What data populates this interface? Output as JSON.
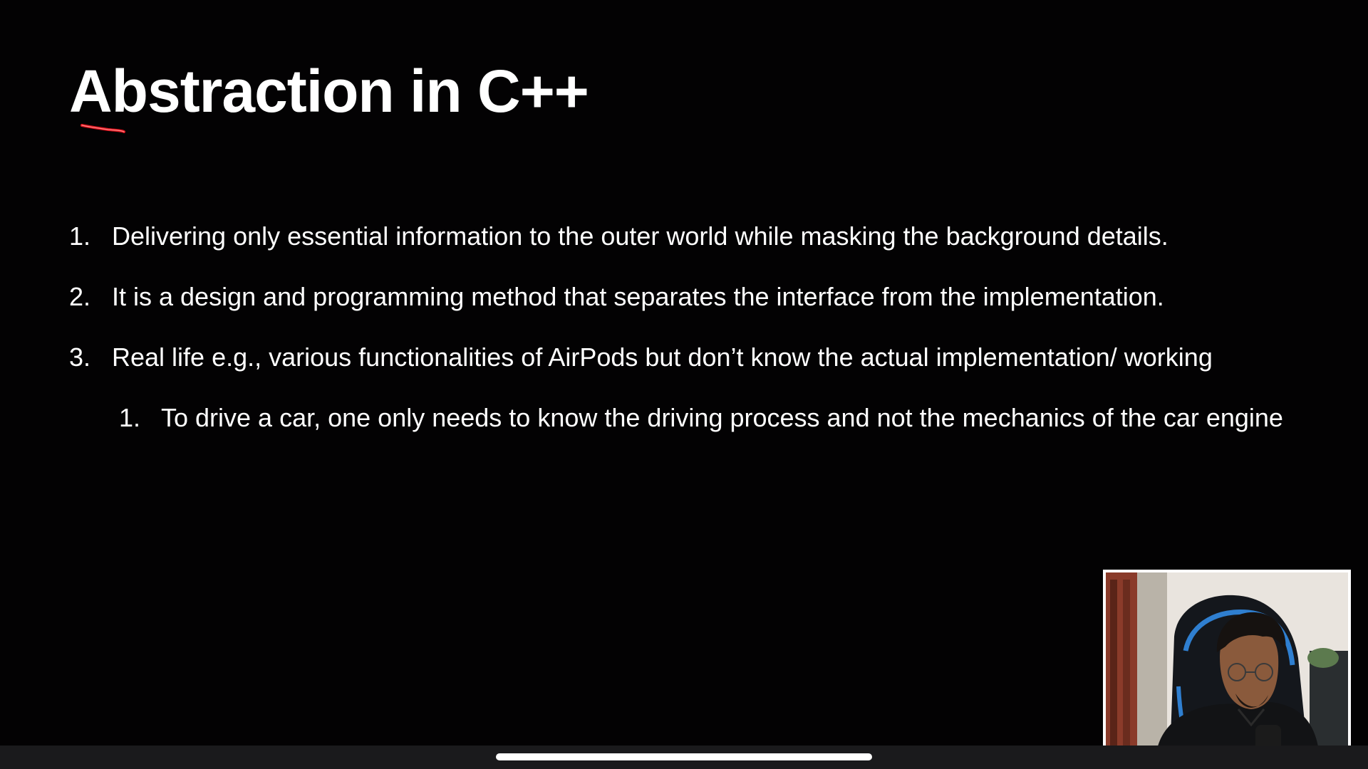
{
  "slide": {
    "title": "Abstraction in C++",
    "items": [
      {
        "number": "1.",
        "text": "Delivering only essential information to the outer world while masking the background details."
      },
      {
        "number": "2.",
        "text": "It is a design and programming method that separates the interface from the implementation."
      },
      {
        "number": "3.",
        "text": "Real life e.g., various functionalities of AirPods but don’t know the actual implementation/ working"
      }
    ],
    "subitems": [
      {
        "number": "1.",
        "text": "To drive a car, one only needs to know the driving process and not the mechanics of the car engine"
      }
    ]
  },
  "annotation": {
    "color": "#e0141e"
  },
  "colors": {
    "background": "#030203",
    "text": "#ffffff",
    "bottom_bar": "#1a1a1c"
  }
}
